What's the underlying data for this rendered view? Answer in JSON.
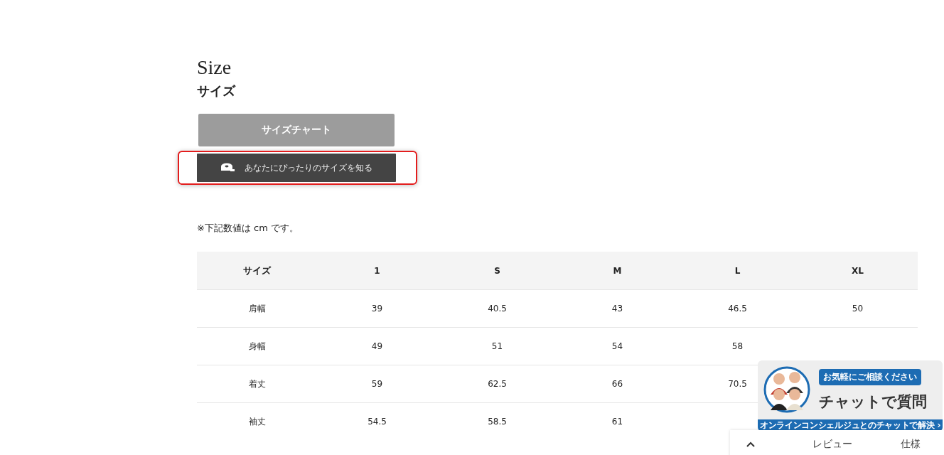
{
  "heading": {
    "title": "Size",
    "subtitle": "サイズ"
  },
  "buttons": [
    {
      "label": "サイズチャート",
      "kind": "chart",
      "highlighted": false
    },
    {
      "label": "あなたにぴったりのサイズを知る",
      "kind": "fit",
      "highlighted": true
    }
  ],
  "note": "※下記数値は cm です。",
  "table": {
    "columns": [
      "サイズ",
      "1",
      "S",
      "M",
      "L",
      "XL"
    ],
    "rows": [
      {
        "label": "肩幅",
        "values": [
          "39",
          "40.5",
          "43",
          "46.5",
          "50"
        ]
      },
      {
        "label": "身幅",
        "values": [
          "49",
          "51",
          "54",
          "58"
        ]
      },
      {
        "label": "着丈",
        "values": [
          "59",
          "62.5",
          "66",
          "70.5"
        ]
      },
      {
        "label": "袖丈",
        "values": [
          "54.5",
          "58.5",
          "61"
        ]
      }
    ]
  },
  "chat_banner": {
    "bubble": "お気軽にご相談ください",
    "title": "チャットで質問",
    "footer": "オンラインコンシェルジュとのチャットで解決 ›"
  },
  "bottom_tabs": [
    "レビュー",
    "仕様"
  ]
}
